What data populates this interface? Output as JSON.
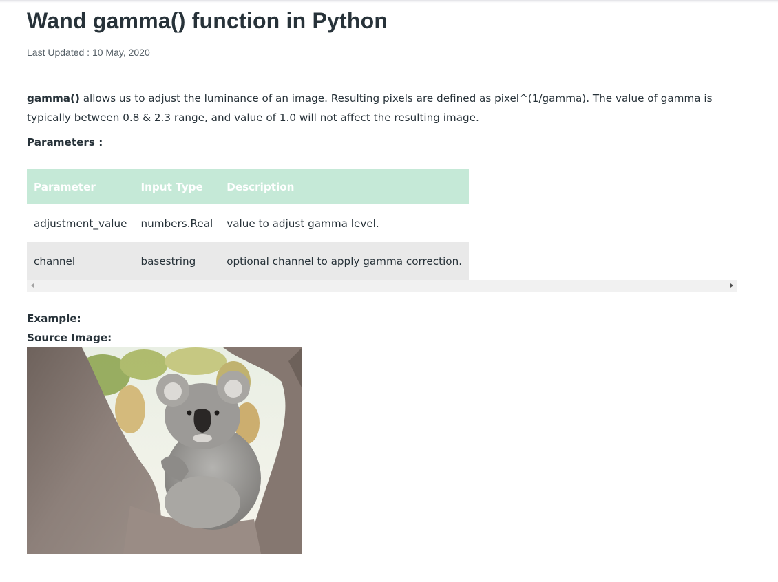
{
  "article": {
    "title": "Wand gamma() function in Python",
    "last_updated": "Last Updated : 10 May, 2020",
    "intro_keyword": "gamma()",
    "intro_text": " allows us to adjust the luminance of an image. Resulting pixels are defined as pixel^(1/gamma). The value of gamma is typically between 0.8 & 2.3 range, and value of 1.0 will not affect the resulting image.",
    "parameters_label": "Parameters :",
    "example_label": "Example:",
    "source_image_label": "Source Image:"
  },
  "params_table": {
    "headers": [
      "Parameter",
      "Input Type",
      "Description"
    ],
    "rows": [
      [
        "adjustment_value",
        "numbers.Real",
        "value to adjust gamma level."
      ],
      [
        "channel",
        "basestring",
        "optional channel to apply gamma correction."
      ]
    ]
  },
  "colors": {
    "header_bg": "#c5e9d7",
    "alt_row_bg": "#e9e9e9",
    "text": "#273239"
  },
  "icons": {
    "scroll_left": "scroll-left-arrow-icon",
    "scroll_right": "scroll-right-arrow-icon"
  }
}
